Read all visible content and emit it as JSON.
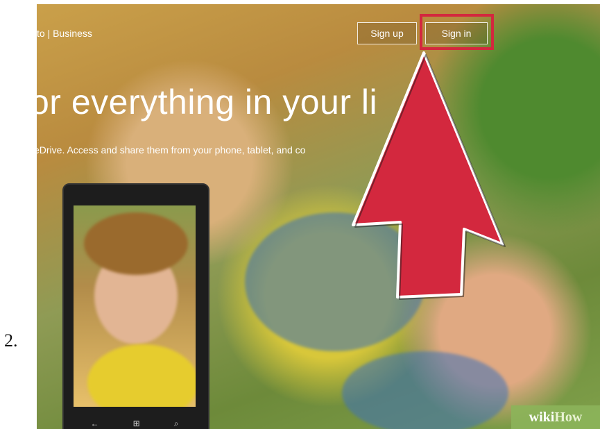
{
  "step": {
    "number": "2."
  },
  "nav": {
    "links": "to  |  Business"
  },
  "buttons": {
    "sign_up": "Sign up",
    "sign_in": "Sign in"
  },
  "hero": {
    "headline": "or everything in your li",
    "subline": "eDrive. Access and share them from your phone, tablet, and co"
  },
  "phone": {
    "nav_icons": [
      "back-icon",
      "windows-icon",
      "search-icon"
    ],
    "nav_glyphs": [
      "←",
      "⊞",
      "⌕"
    ]
  },
  "watermark": {
    "wiki": "wiki",
    "how": "How"
  },
  "colors": {
    "highlight": "#d3283e",
    "arrow": "#d3283e"
  }
}
